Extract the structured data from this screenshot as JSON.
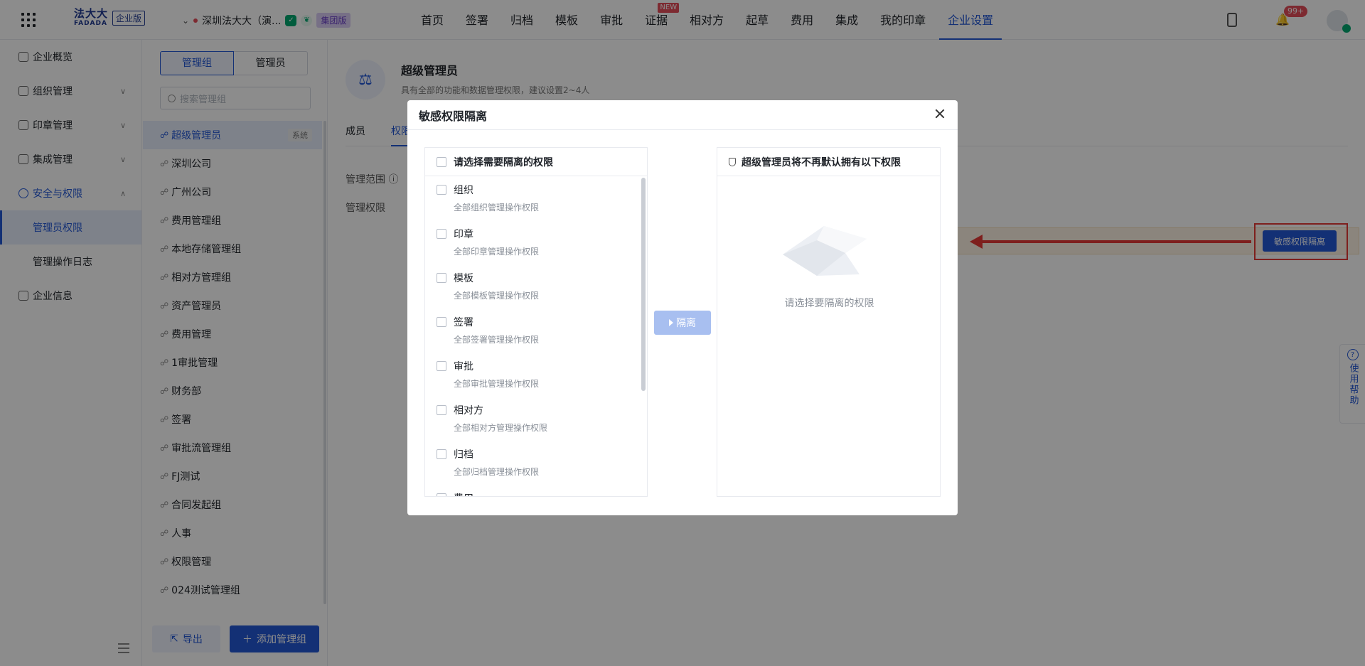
{
  "topbar": {
    "logo_cn": "法大大",
    "logo_en": "FADADA",
    "logo_badge": "企业版",
    "org_name": "深圳法大大（演...",
    "group_badge": "集团版",
    "nav": [
      {
        "label": "首页"
      },
      {
        "label": "签署"
      },
      {
        "label": "归档"
      },
      {
        "label": "模板"
      },
      {
        "label": "审批"
      },
      {
        "label": "证据",
        "badge": "NEW"
      },
      {
        "label": "相对方"
      },
      {
        "label": "起草"
      },
      {
        "label": "费用"
      },
      {
        "label": "集成"
      },
      {
        "label": "我的印章"
      },
      {
        "label": "企业设置",
        "active": true
      }
    ],
    "notif_count": "99+"
  },
  "sidebar": {
    "items": [
      {
        "label": "企业概览"
      },
      {
        "label": "组织管理"
      },
      {
        "label": "印章管理"
      },
      {
        "label": "集成管理"
      },
      {
        "label": "安全与权限"
      },
      {
        "label": "管理员权限"
      },
      {
        "label": "管理操作日志"
      },
      {
        "label": "企业信息"
      }
    ]
  },
  "groups": {
    "seg_group": "管理组",
    "seg_admin": "管理员",
    "search_placeholder": "搜索管理组",
    "sys_tag": "系统",
    "list": [
      "超级管理员",
      "深圳公司",
      "广州公司",
      "费用管理组",
      "本地存储管理组",
      "相对方管理组",
      "资产管理员",
      "费用管理",
      "1审批管理",
      "财务部",
      "签署",
      "审批流管理组",
      "FJ测试",
      "合同发起组",
      "人事",
      "权限管理",
      "024测试管理组"
    ],
    "export_label": "导出",
    "add_label": "添加管理组"
  },
  "main": {
    "role_title": "超级管理员",
    "role_desc": "具有全部的功能和数据管理权限，建议设置2~4人",
    "tab_members": "成员",
    "tab_perm": "权限",
    "label_scope": "管理范围",
    "label_perm": "管理权限",
    "sensitive_btn": "敏感权限隔离",
    "help": "使用帮助"
  },
  "dialog": {
    "title": "敏感权限隔离",
    "left_header": "请选择需要隔离的权限",
    "perms": [
      {
        "name": "组织",
        "desc": "全部组织管理操作权限"
      },
      {
        "name": "印章",
        "desc": "全部印章管理操作权限"
      },
      {
        "name": "模板",
        "desc": "全部模板管理操作权限"
      },
      {
        "name": "签署",
        "desc": "全部签署管理操作权限"
      },
      {
        "name": "审批",
        "desc": "全部审批管理操作权限"
      },
      {
        "name": "相对方",
        "desc": "全部相对方管理操作权限"
      },
      {
        "name": "归档",
        "desc": "全部归档管理操作权限"
      },
      {
        "name": "费用",
        "desc": ""
      }
    ],
    "isolate_btn": "隔离",
    "right_header": "超级管理员将不再默认拥有以下权限",
    "empty_text": "请选择要隔离的权限"
  }
}
